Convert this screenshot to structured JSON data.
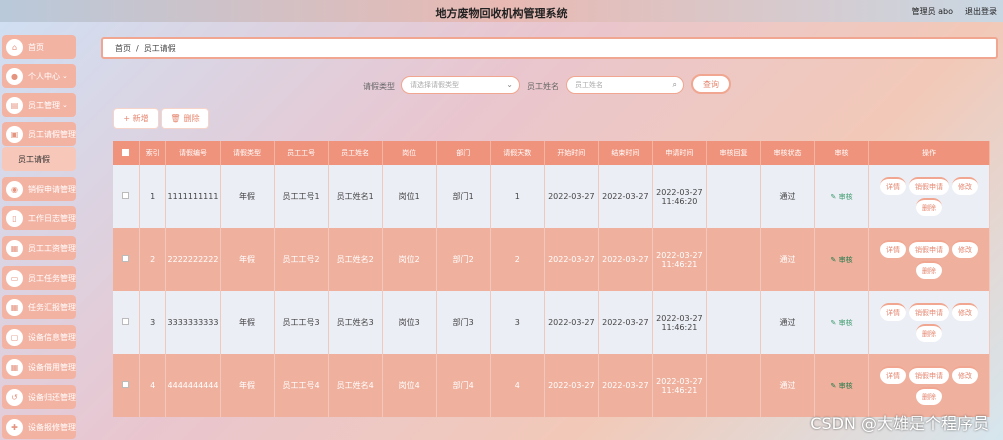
{
  "header": {
    "title": "地方废物回收机构管理系统",
    "user": "管理员 abo",
    "logout": "退出登录"
  },
  "sidebar": {
    "items": [
      {
        "label": "首页",
        "icon": "home-icon",
        "caret": ""
      },
      {
        "label": "个人中心",
        "icon": "user-icon",
        "caret": "⌄"
      },
      {
        "label": "员工管理",
        "icon": "users-icon",
        "caret": "⌄"
      },
      {
        "label": "员工请假管理",
        "icon": "briefcase-icon",
        "caret": ""
      },
      {
        "label": "员工请假",
        "icon": "",
        "caret": ""
      },
      {
        "label": "销假申请管理",
        "icon": "location-icon",
        "caret": ""
      },
      {
        "label": "工作日志管理",
        "icon": "document-icon",
        "caret": ""
      },
      {
        "label": "员工工资管理",
        "icon": "grid-icon",
        "caret": ""
      },
      {
        "label": "员工任务管理",
        "icon": "clipboard-icon",
        "caret": ""
      },
      {
        "label": "任务汇报管理",
        "icon": "grid-icon",
        "caret": ""
      },
      {
        "label": "设备信息管理",
        "icon": "device-icon",
        "caret": ""
      },
      {
        "label": "设备借用管理",
        "icon": "grid-icon",
        "caret": ""
      },
      {
        "label": "设备归还管理",
        "icon": "return-icon",
        "caret": ""
      },
      {
        "label": "设备报修管理",
        "icon": "wrench-icon",
        "caret": ""
      }
    ]
  },
  "breadcrumb": {
    "home": "首页",
    "sep": "/",
    "current": "员工请假"
  },
  "search": {
    "type_label": "请假类型",
    "type_placeholder": "请选择请假类型",
    "name_label": "员工姓名",
    "name_placeholder": "员工姓名",
    "query_button": "查询"
  },
  "toolbar": {
    "add": "+ 新增",
    "delete": "删除"
  },
  "table": {
    "headers": [
      "",
      "索引",
      "请假编号",
      "请假类型",
      "员工工号",
      "员工姓名",
      "岗位",
      "部门",
      "请假天数",
      "开始时间",
      "结束时间",
      "申请时间",
      "审核回复",
      "审核状态",
      "审核",
      "操作"
    ],
    "rows": [
      {
        "index": "1",
        "code": "1111111111",
        "type": "年假",
        "emp_no": "员工工号1",
        "emp_name": "员工姓名1",
        "post": "岗位1",
        "dept": "部门1",
        "days": "1",
        "start": "2022-03-27",
        "end": "2022-03-27",
        "apply": "2022-03-27 11:46:20",
        "reply": "",
        "status": "通过",
        "audit": "✎ 审核"
      },
      {
        "index": "2",
        "code": "2222222222",
        "type": "年假",
        "emp_no": "员工工号2",
        "emp_name": "员工姓名2",
        "post": "岗位2",
        "dept": "部门2",
        "days": "2",
        "start": "2022-03-27",
        "end": "2022-03-27",
        "apply": "2022-03-27 11:46:21",
        "reply": "",
        "status": "通过",
        "audit": "✎ 审核"
      },
      {
        "index": "3",
        "code": "3333333333",
        "type": "年假",
        "emp_no": "员工工号3",
        "emp_name": "员工姓名3",
        "post": "岗位3",
        "dept": "部门3",
        "days": "3",
        "start": "2022-03-27",
        "end": "2022-03-27",
        "apply": "2022-03-27 11:46:21",
        "reply": "",
        "status": "通过",
        "audit": "✎ 审核"
      },
      {
        "index": "4",
        "code": "4444444444",
        "type": "年假",
        "emp_no": "员工工号4",
        "emp_name": "员工姓名4",
        "post": "岗位4",
        "dept": "部门4",
        "days": "4",
        "start": "2022-03-27",
        "end": "2022-03-27",
        "apply": "2022-03-27 11:46:21",
        "reply": "",
        "status": "通过",
        "audit": "✎ 审核"
      }
    ],
    "actions": {
      "detail": "详情",
      "cancel": "销假申请",
      "edit": "修改",
      "delete": "删除"
    }
  },
  "watermark": "CSDN @大雄是个程序员",
  "colors": {
    "accent": "#f0937c",
    "row_even": "#efb09d",
    "row_odd": "#eceef6"
  }
}
